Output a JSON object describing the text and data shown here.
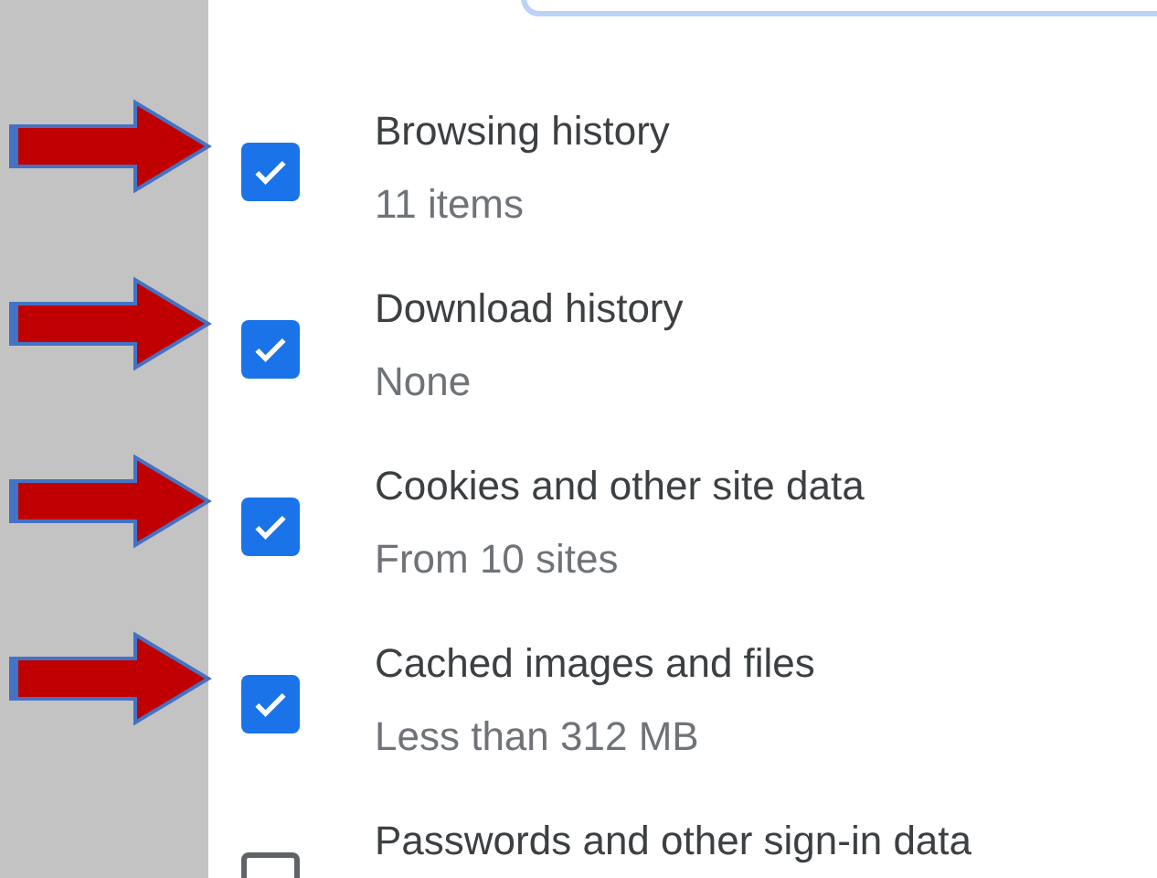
{
  "items": [
    {
      "title": "Browsing history",
      "detail": "11 items",
      "checked": true,
      "arrow": true
    },
    {
      "title": "Download history",
      "detail": "None",
      "checked": true,
      "arrow": true
    },
    {
      "title": "Cookies and other site data",
      "detail": "From 10 sites",
      "checked": true,
      "arrow": true
    },
    {
      "title": "Cached images and files",
      "detail": "Less than 312 MB",
      "checked": true,
      "arrow": true
    },
    {
      "title": "Passwords and other sign-in data",
      "checked": false,
      "arrow": false
    }
  ]
}
